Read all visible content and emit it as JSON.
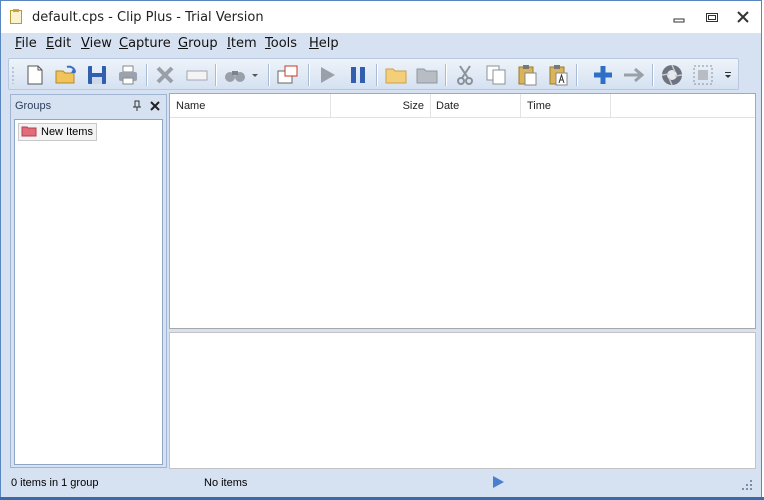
{
  "window": {
    "title": "default.cps - Clip Plus - Trial Version",
    "accent": "#d6e2f1"
  },
  "menu": [
    {
      "key": "F",
      "rest": "ile"
    },
    {
      "key": "E",
      "rest": "dit"
    },
    {
      "key": "V",
      "rest": "iew"
    },
    {
      "key": "C",
      "rest": "apture"
    },
    {
      "key": "G",
      "rest": "roup"
    },
    {
      "key": "I",
      "rest": "tem"
    },
    {
      "key": "T",
      "rest": "ools"
    },
    {
      "key": "H",
      "rest": "elp"
    }
  ],
  "toolbar": {
    "icons": [
      "new-file-icon",
      "open-icon",
      "save-icon",
      "print-icon",
      "delete-icon",
      "rename-icon",
      "find-icon",
      "capture-region-icon",
      "play-icon",
      "pause-icon",
      "new-folder-icon",
      "folder-icon",
      "cut-icon",
      "copy-icon",
      "paste-icon",
      "paste-special-icon",
      "add-icon",
      "move-arrow-icon",
      "camera-shutter-icon",
      "select-area-icon",
      "overflow-chevron-icon"
    ]
  },
  "groups_pane": {
    "title": "Groups",
    "items": [
      "New Items"
    ]
  },
  "list": {
    "columns": [
      "Name",
      "Size",
      "Date",
      "Time"
    ]
  },
  "status": {
    "left": "0 items in 1 group",
    "middle": "No items"
  }
}
